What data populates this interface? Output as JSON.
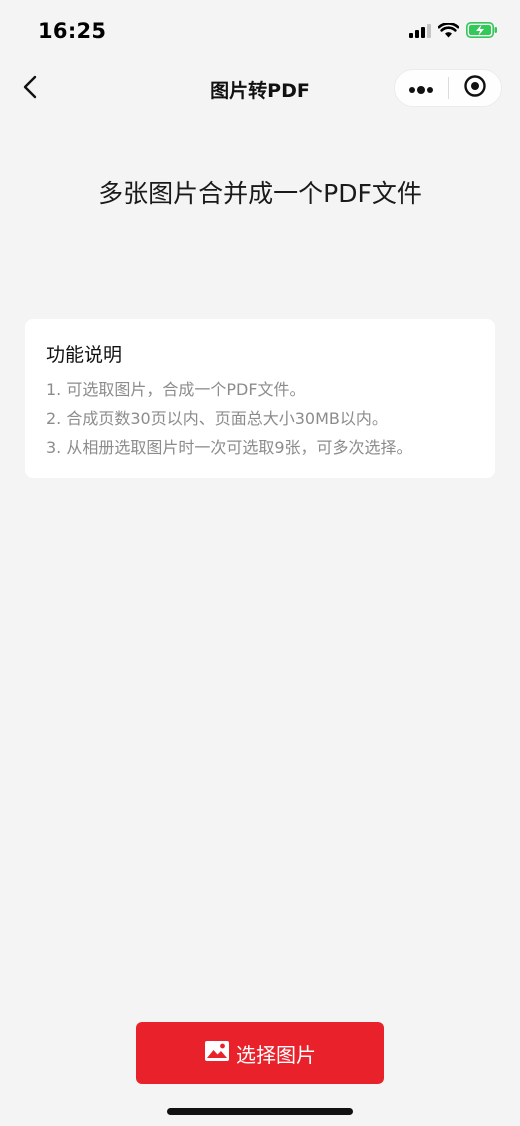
{
  "status_bar": {
    "time": "16:25"
  },
  "nav": {
    "title": "图片转PDF",
    "back_icon": "chevron-left-icon",
    "more_icon": "more-dots-icon",
    "close_icon": "target-circle-icon"
  },
  "headline": "多张图片合并成一个PDF文件",
  "info": {
    "title": "功能说明",
    "lines": [
      "1. 可选取图片，合成一个PDF文件。",
      "2. 合成页数30页以内、页面总大小30MB以内。",
      "3. 从相册选取图片时一次可选取9张，可多次选择。"
    ]
  },
  "select_button": {
    "label": "选择图片",
    "icon": "image-icon"
  },
  "colors": {
    "accent": "#e8212a",
    "background": "#f4f4f4",
    "card": "#ffffff",
    "secondary_text": "#8c8c8c",
    "battery": "#34c759"
  }
}
